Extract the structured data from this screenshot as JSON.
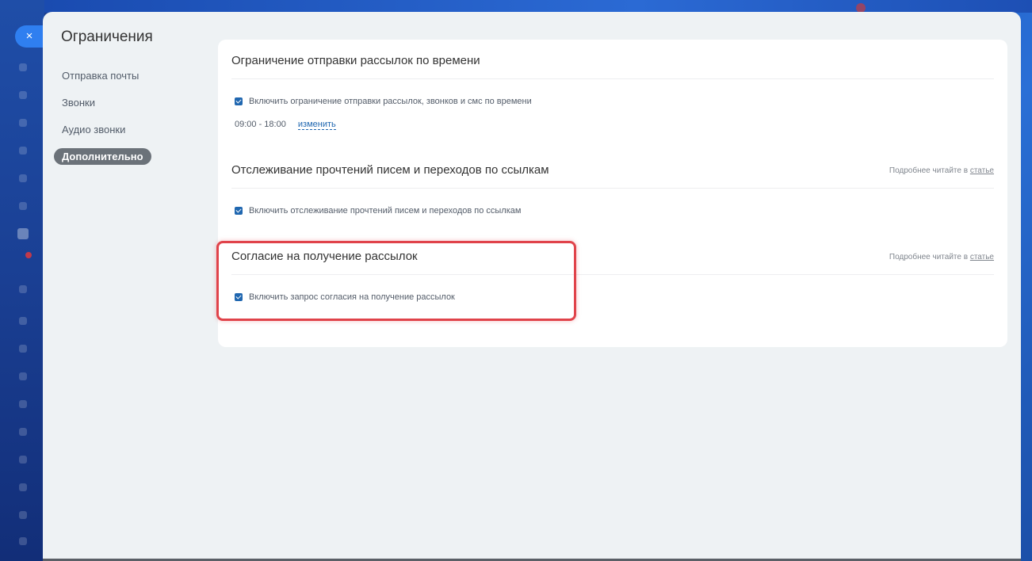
{
  "slider": {
    "title": "Ограничения",
    "close_icon": "×"
  },
  "side_menu": {
    "items": [
      {
        "label": "Отправка почты",
        "active": false
      },
      {
        "label": "Звонки",
        "active": false
      },
      {
        "label": "Аудио звонки",
        "active": false
      },
      {
        "label": "Дополнительно",
        "active": true
      }
    ]
  },
  "sections": {
    "time_limit": {
      "title": "Ограничение отправки рассылок по времени",
      "checkbox_label": "Включить ограничение отправки рассылок, звонков и смс по времени",
      "checked": true,
      "time_range": "09:00 - 18:00",
      "change_link": "изменить"
    },
    "tracking": {
      "title": "Отслеживание прочтений писем и переходов по ссылкам",
      "more_text": "Подробнее читайте в",
      "more_link": "статье",
      "checkbox_label": "Включить отслеживание прочтений писем и переходов по ссылкам",
      "checked": true
    },
    "consent": {
      "title": "Согласие на получение рассылок",
      "more_text": "Подробнее читайте в",
      "more_link": "статье",
      "checkbox_label": "Включить запрос согласия на получение рассылок",
      "checked": true
    }
  },
  "colors": {
    "accent": "#2067b0",
    "highlight": "#e0434a",
    "active_menu_bg": "#6b7279",
    "panel_bg": "#eef2f4"
  }
}
